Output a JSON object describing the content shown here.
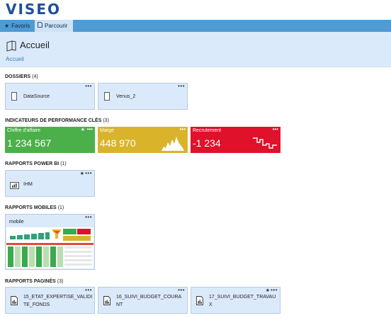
{
  "app": {
    "logo": "VISEO"
  },
  "tabs": [
    {
      "label": "Favoris",
      "icon": "star-icon"
    },
    {
      "label": "Parcourir",
      "icon": "document-icon"
    }
  ],
  "header": {
    "title": "Accueil",
    "icon": "book-icon",
    "breadcrumb": "Accueil"
  },
  "sections": {
    "dossiers": {
      "title": "DOSSIERS",
      "count": "(4)"
    },
    "kpis": {
      "title": "INDICATEURS DE PERFORMANCE CLÉS",
      "count": "(3)"
    },
    "powerbi": {
      "title": "RAPPORTS POWER BI",
      "count": "(1)"
    },
    "mobile": {
      "title": "RAPPORTS MOBILES",
      "count": "(1)"
    },
    "pagines": {
      "title": "RAPPORTS PAGINÉS",
      "count": "(3)"
    }
  },
  "folders": [
    {
      "label": "DataSource",
      "icon": "folder-icon"
    },
    {
      "label": "Venus_2",
      "icon": "folder-icon"
    }
  ],
  "kpi_tiles": [
    {
      "name": "Chiffre d'affaire",
      "value": "1 234 567",
      "color": "#4bb04a",
      "favorite": true
    },
    {
      "name": "Marge",
      "value": "448 970",
      "color": "#d9b42b",
      "favorite": false
    },
    {
      "name": "Recrutement",
      "value": "-1 234",
      "color": "#e0112b",
      "favorite": false
    }
  ],
  "powerbi_reports": [
    {
      "label": "IHM",
      "icon": "powerbi-icon",
      "favorite": true
    }
  ],
  "mobile_reports": [
    {
      "label": "mobile"
    }
  ],
  "paginated_reports": [
    {
      "label": "15_ETAT_EXPERTISE_VALIDITE_FONDS",
      "line1": "15_ETAT_EXPERTISE_VALIDI",
      "line2": "TE_FONDS",
      "favorite": false
    },
    {
      "label": "16_SUIVI_BUDGET_COURANT",
      "line1": "16_SUIVI_BUDGET_COURA",
      "line2": "NT",
      "favorite": false
    },
    {
      "label": "17_SUIVI_BUDGET_TRAVAUX",
      "line1": "17_SUIVI_BUDGET_TRAVAU",
      "line2": "X",
      "favorite": true
    }
  ],
  "menu_glyph": "•••",
  "star_glyph": "★"
}
